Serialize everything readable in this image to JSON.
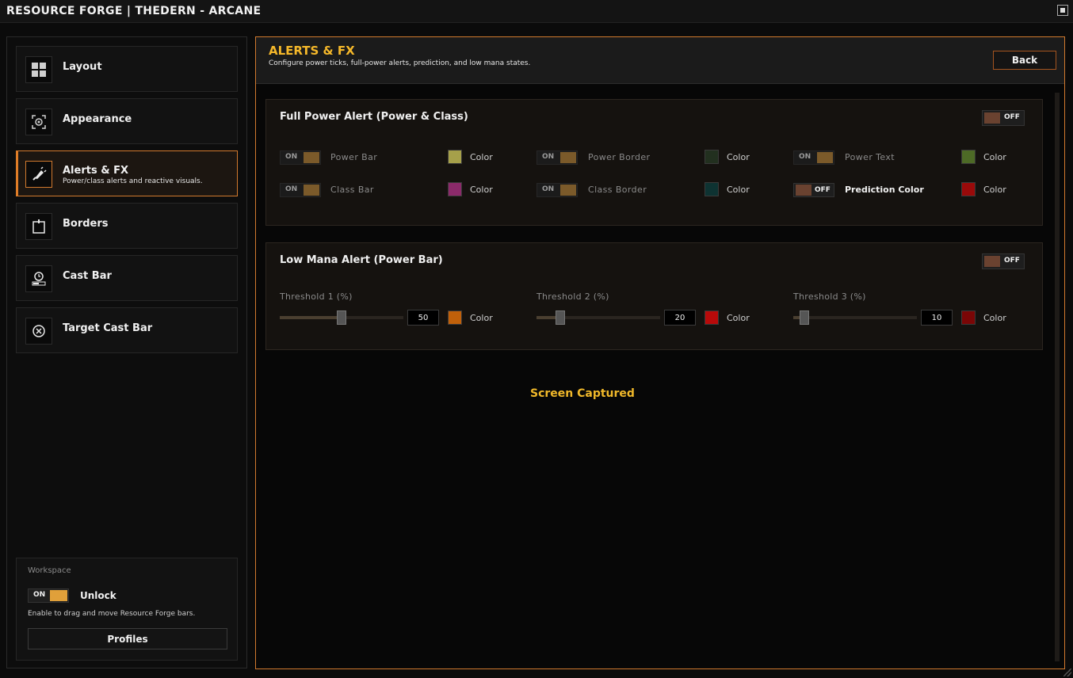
{
  "window": {
    "title": "RESOURCE FORGE | THEDERN - ARCANE"
  },
  "sidebar": {
    "items": [
      {
        "label": "Layout",
        "icon": "grid-icon",
        "sub": ""
      },
      {
        "label": "Appearance",
        "icon": "palette-icon",
        "sub": ""
      },
      {
        "label": "Alerts & FX",
        "icon": "bell-icon",
        "sub": "Power/class alerts and reactive visuals.",
        "active": true
      },
      {
        "label": "Borders",
        "icon": "border-icon",
        "sub": ""
      },
      {
        "label": "Cast Bar",
        "icon": "clock-icon",
        "sub": ""
      },
      {
        "label": "Target Cast Bar",
        "icon": "target-icon",
        "sub": ""
      }
    ],
    "workspace": {
      "heading": "Workspace",
      "toggle_state": "ON",
      "toggle_label": "Unlock",
      "description": "Enable to drag and move Resource Forge bars.",
      "profiles_label": "Profiles"
    }
  },
  "main": {
    "title": "ALERTS & FX",
    "subtitle": "Configure power ticks, full-power alerts, prediction, and low mana states.",
    "back_label": "Back",
    "full_power": {
      "title": "Full Power Alert (Power & Class)",
      "toggle_state": "OFF",
      "rows": [
        {
          "state": "ON",
          "label": "Power Bar",
          "color_label": "Color",
          "color": "#a6a04a"
        },
        {
          "state": "ON",
          "label": "Power Border",
          "color_label": "Color",
          "color": "#22301f"
        },
        {
          "state": "ON",
          "label": "Power Text",
          "color_label": "Color",
          "color": "#4d6a26"
        },
        {
          "state": "ON",
          "label": "Class Bar",
          "color_label": "Color",
          "color": "#8b2a6a"
        },
        {
          "state": "ON",
          "label": "Class Border",
          "color_label": "Color",
          "color": "#0e3332"
        },
        {
          "state": "OFF",
          "label": "Prediction Color",
          "color_label": "Color",
          "color": "#9a0a0a"
        }
      ]
    },
    "low_mana": {
      "title": "Low Mana Alert (Power Bar)",
      "toggle_state": "OFF",
      "thresholds": [
        {
          "label": "Threshold 1 (%)",
          "value": "50",
          "color_label": "Color",
          "color": "#c0600a"
        },
        {
          "label": "Threshold 2 (%)",
          "value": "20",
          "color_label": "Color",
          "color": "#b80a0a"
        },
        {
          "label": "Threshold 3 (%)",
          "value": "10",
          "color_label": "Color",
          "color": "#7a0606"
        }
      ]
    },
    "status_text": "Screen Captured"
  }
}
